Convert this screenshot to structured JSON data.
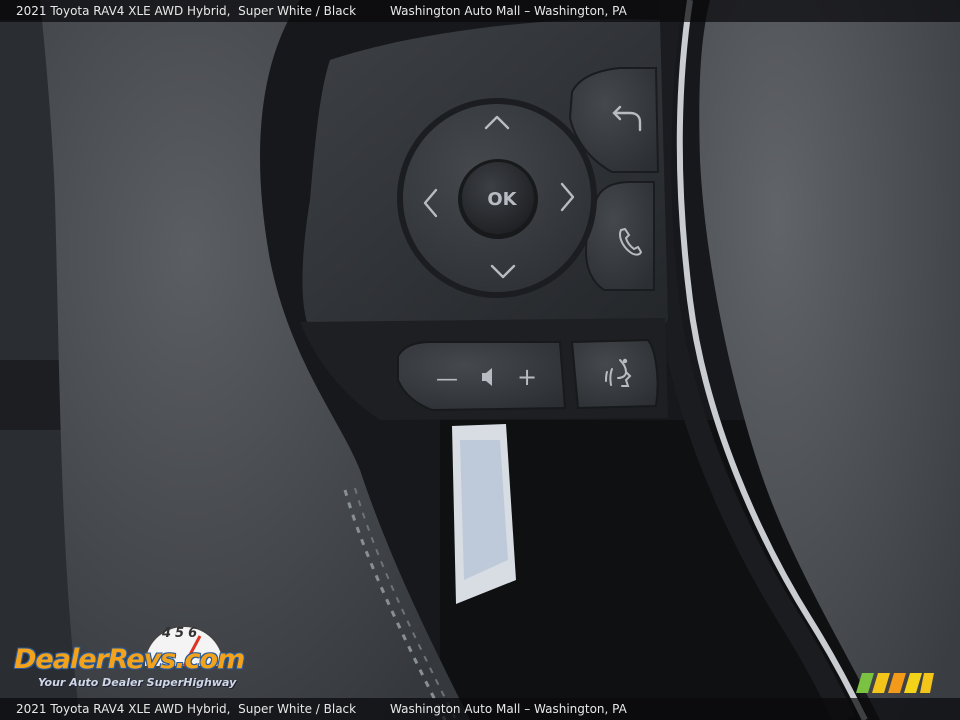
{
  "caption": {
    "vehicle": "2021 Toyota RAV4 XLE AWD Hybrid,  Super White / Black",
    "dealer": "Washington Auto Mall – Washington, PA"
  },
  "controls": {
    "ok_label": "OK",
    "minus_label": "—",
    "plus_label": "+"
  },
  "watermark": {
    "brand": "DealerRevs.com",
    "tagline": "Your Auto Dealer SuperHighway",
    "gauge_digits": "456"
  },
  "icons": [
    "up-arrow-icon",
    "down-arrow-icon",
    "left-arrow-icon",
    "right-arrow-icon",
    "back-icon",
    "phone-icon",
    "volume-icon",
    "voice-command-icon"
  ],
  "colors": {
    "leather": "#4a4d52",
    "control_panel": "#2c2f33",
    "button": "#34373c",
    "symbol": "#b8bcc2",
    "watermark_orange": "#f2a31b",
    "watermark_blue": "#2a5a9a"
  }
}
